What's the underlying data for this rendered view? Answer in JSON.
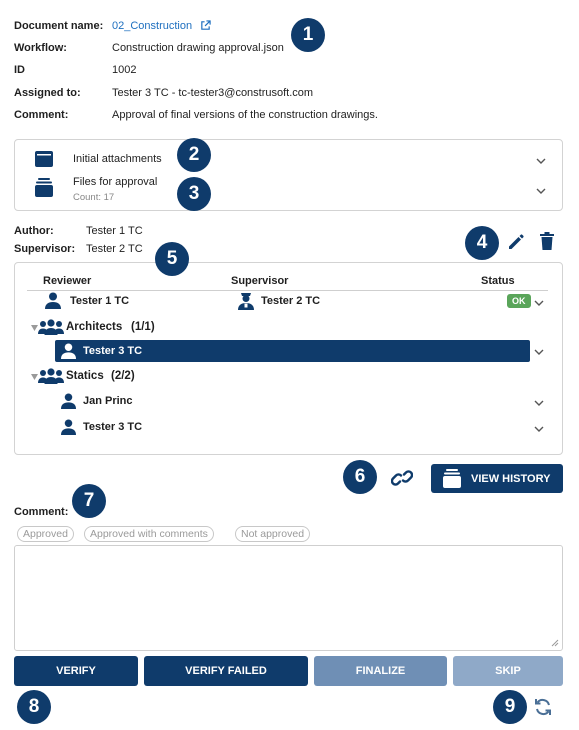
{
  "info": {
    "document_name_label": "Document name:",
    "document_name_value": "02_Construction",
    "workflow_label": "Workflow:",
    "workflow_value": "Construction drawing approval.json",
    "id_label": "ID",
    "id_value": "1002",
    "assigned_label": "Assigned to:",
    "assigned_value": "Tester 3 TC - tc-tester3@construsoft.com",
    "comment_label": "Comment:",
    "comment_value": "Approval of final versions of the construction drawings."
  },
  "badges": [
    "1",
    "2",
    "3",
    "4",
    "5",
    "6",
    "7",
    "8",
    "9"
  ],
  "attachments": {
    "initial_label": "Initial attachments",
    "files_label": "Files for approval",
    "files_count": "Count: 17"
  },
  "people": {
    "author_label": "Author:",
    "author_value": "Tester 1 TC",
    "supervisor_label": "Supervisor:",
    "supervisor_value": "Tester 2 TC"
  },
  "reviewers": {
    "headers": {
      "reviewer": "Reviewer",
      "supervisor": "Supervisor",
      "status": "Status"
    },
    "main_row": {
      "reviewer": "Tester 1 TC",
      "supervisor": "Tester 2 TC",
      "status": "OK"
    },
    "groups": [
      {
        "name": "Architects",
        "count": "(1/1)",
        "members": [
          "Tester 3 TC"
        ]
      },
      {
        "name": "Statics",
        "count": "(2/2)",
        "members": [
          "Jan Princ",
          "Tester 3 TC"
        ]
      }
    ]
  },
  "history_button": "VIEW HISTORY",
  "comment": {
    "label": "Comment:",
    "chips": [
      "Approved",
      "Approved with comments",
      "Not approved"
    ],
    "text": ""
  },
  "actions": {
    "verify": "VERIFY",
    "verify_failed": "VERIFY FAILED",
    "finalize": "FINALIZE",
    "skip": "SKIP"
  },
  "colors": {
    "primary": "#0f3b6b",
    "disabled": "#6f8fb5",
    "link": "#1e6fbf",
    "ok": "#5aa55a"
  }
}
